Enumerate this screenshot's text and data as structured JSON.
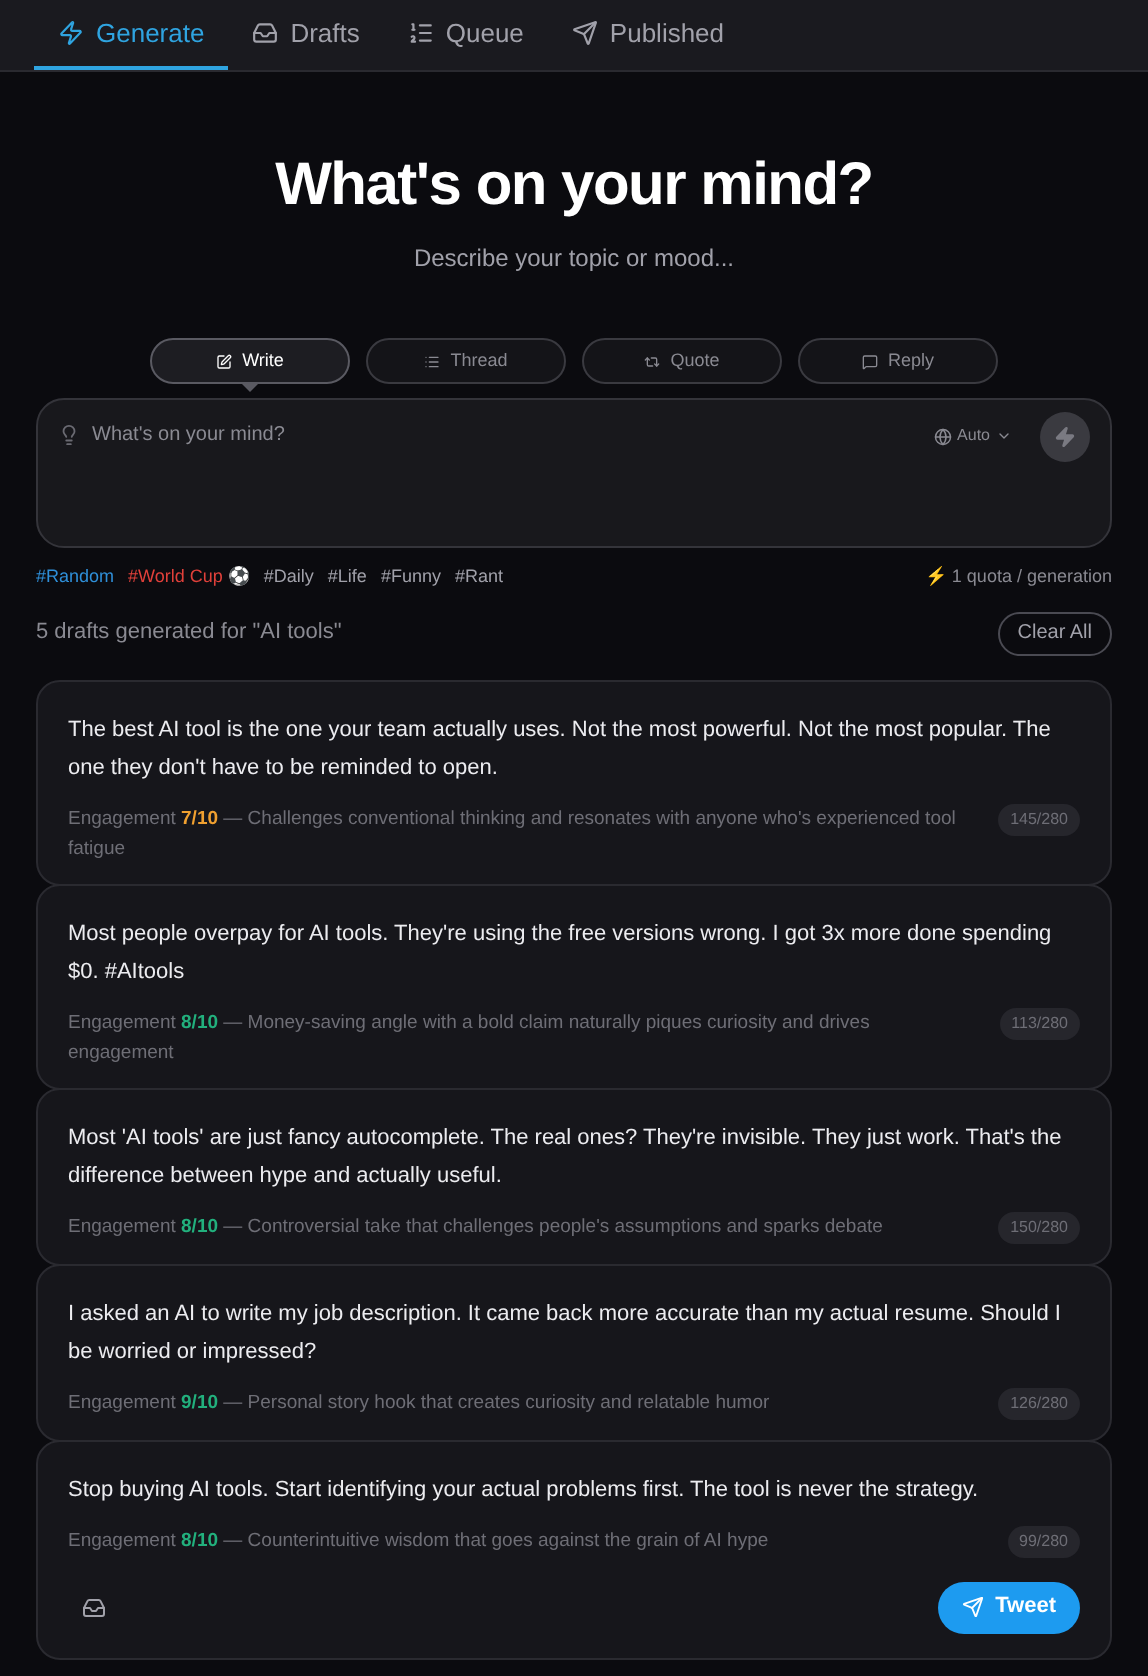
{
  "tabs": [
    {
      "label": "Generate",
      "selected": true
    },
    {
      "label": "Drafts",
      "selected": false
    },
    {
      "label": "Queue",
      "selected": false
    },
    {
      "label": "Published",
      "selected": false
    }
  ],
  "heading": "What's on your mind?",
  "subheading": "Describe your topic or mood...",
  "modes": [
    {
      "label": "Write",
      "selected": true
    },
    {
      "label": "Thread",
      "selected": false
    },
    {
      "label": "Quote",
      "selected": false
    },
    {
      "label": "Reply",
      "selected": false
    }
  ],
  "composer": {
    "placeholder": "What's on your mind?",
    "language": "Auto"
  },
  "hashtags": [
    {
      "label": "#Random",
      "color": "#2f8fd8"
    },
    {
      "label": "#World Cup ⚽",
      "color": "#e0403a"
    },
    {
      "label": "#Daily",
      "color": "#a1a1aa"
    },
    {
      "label": "#Life",
      "color": "#a1a1aa"
    },
    {
      "label": "#Funny",
      "color": "#a1a1aa"
    },
    {
      "label": "#Rant",
      "color": "#a1a1aa"
    }
  ],
  "quota": "⚡ 1 quota / generation",
  "summary": "5 drafts generated for \"AI tools\"",
  "clear_button": "Clear All",
  "drafts": [
    {
      "text": "The best AI tool is the one your team actually uses. Not the most powerful. Not the most popular. The one they don't have to be reminded to open.",
      "label": "Engagement",
      "score": "7/10",
      "color": "#f0a030",
      "reason": "— Challenges conventional thinking and resonates with anyone who's experienced tool fatigue",
      "count": "145/280"
    },
    {
      "text": "Most people overpay for AI tools. They're using the free versions wrong. I got 3x more done spending $0. #AItools",
      "label": "Engagement",
      "score": "8/10",
      "color": "#22b07d",
      "reason": "— Money-saving angle with a bold claim naturally piques curiosity and drives engagement",
      "count": "113/280"
    },
    {
      "text": "Most 'AI tools' are just fancy autocomplete. The real ones? They're invisible. They just work. That's the difference between hype and actually useful.",
      "label": "Engagement",
      "score": "8/10",
      "color": "#22b07d",
      "reason": "— Controversial take that challenges people's assumptions and sparks debate",
      "count": "150/280"
    },
    {
      "text": "I asked an AI to write my job description. It came back more accurate than my actual resume. Should I be worried or impressed?",
      "label": "Engagement",
      "score": "9/10",
      "color": "#22b07d",
      "reason": "— Personal story hook that creates curiosity and relatable humor",
      "count": "126/280"
    },
    {
      "text": "Stop buying AI tools. Start identifying your actual problems first. The tool is never the strategy.",
      "label": "Engagement",
      "score": "8/10",
      "color": "#22b07d",
      "reason": "— Counterintuitive wisdom that goes against the grain of AI hype",
      "count": "99/280",
      "tweet_button": "Tweet"
    }
  ]
}
